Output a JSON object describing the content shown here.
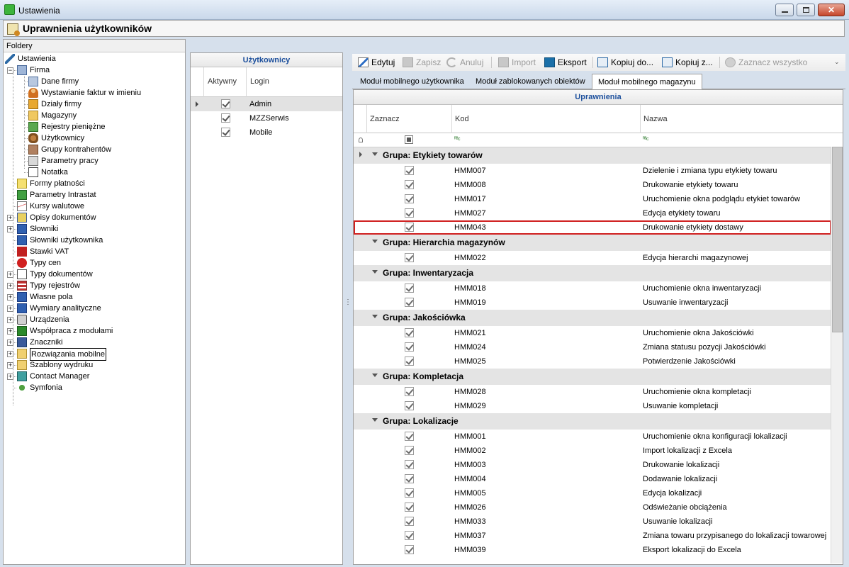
{
  "window": {
    "title": "Ustawienia",
    "close_glyph": "✕"
  },
  "header": {
    "title": "Uprawnienia użytkowników"
  },
  "folders": {
    "title": "Foldery",
    "items": [
      {
        "label": "Ustawienia",
        "icon": "tools-icon",
        "level": 0
      },
      {
        "label": "Firma",
        "icon": "company-icon",
        "level": 1,
        "expander": "−"
      },
      {
        "label": "Dane firmy",
        "icon": "company-data-icon",
        "level": 2
      },
      {
        "label": "Wystawianie faktur w imieniu",
        "icon": "person-icon",
        "level": 2
      },
      {
        "label": "Działy firmy",
        "icon": "departments-icon",
        "level": 2
      },
      {
        "label": "Magazyny",
        "icon": "warehouse-icon",
        "level": 2
      },
      {
        "label": "Rejestry pieniężne",
        "icon": "money-register-icon",
        "level": 2
      },
      {
        "label": "Użytkownicy",
        "icon": "users-icon",
        "level": 2
      },
      {
        "label": "Grupy kontrahentów",
        "icon": "contractor-groups-icon",
        "level": 2
      },
      {
        "label": "Parametry pracy",
        "icon": "parameters-icon",
        "level": 2
      },
      {
        "label": "Notatka",
        "icon": "note-icon",
        "level": 2
      },
      {
        "label": "Formy płatności",
        "icon": "payment-forms-icon",
        "level": 1
      },
      {
        "label": "Parametry Intrastat",
        "icon": "intrastat-icon",
        "level": 1
      },
      {
        "label": "Kursy walutowe",
        "icon": "currency-chart-icon",
        "level": 1
      },
      {
        "label": "Opisy dokumentów",
        "icon": "document-descriptions-icon",
        "level": 1,
        "expander": "+"
      },
      {
        "label": "Słowniki",
        "icon": "dictionary-icon",
        "level": 1,
        "expander": "+"
      },
      {
        "label": "Słowniki użytkownika",
        "icon": "user-dictionary-icon",
        "level": 1
      },
      {
        "label": "Stawki VAT",
        "icon": "vat-icon",
        "level": 1
      },
      {
        "label": "Typy cen",
        "icon": "price-types-icon",
        "level": 1
      },
      {
        "label": "Typy dokumentów",
        "icon": "document-types-icon",
        "level": 1,
        "expander": "+"
      },
      {
        "label": "Typy rejestrów",
        "icon": "register-types-icon",
        "level": 1,
        "expander": "+"
      },
      {
        "label": "Własne pola",
        "icon": "custom-fields-icon",
        "level": 1,
        "expander": "+"
      },
      {
        "label": "Wymiary analityczne",
        "icon": "analytical-dimensions-icon",
        "level": 1,
        "expander": "+"
      },
      {
        "label": "Urządzenia",
        "icon": "printer-icon",
        "level": 1,
        "expander": "+"
      },
      {
        "label": "Współpraca z modułami",
        "icon": "modules-icon",
        "level": 1,
        "expander": "+"
      },
      {
        "label": "Znaczniki",
        "icon": "tags-icon",
        "level": 1,
        "expander": "+"
      },
      {
        "label": "Rozwiązania mobilne",
        "icon": "folder-icon",
        "level": 1,
        "expander": "+",
        "selected": true
      },
      {
        "label": "Szablony wydruku",
        "icon": "folder-icon",
        "level": 1,
        "expander": "+"
      },
      {
        "label": "Contact Manager",
        "icon": "contact-manager-icon",
        "level": 1,
        "expander": "+"
      },
      {
        "label": "Symfonia",
        "icon": "symfonia-icon",
        "level": 1
      }
    ]
  },
  "users": {
    "title": "Użytkownicy",
    "columns": {
      "active": "Aktywny",
      "login": "Login"
    },
    "rows": [
      {
        "login": "Admin",
        "active": true,
        "current": true
      },
      {
        "login": "MZZSerwis",
        "active": true
      },
      {
        "login": "Mobile",
        "active": true
      }
    ]
  },
  "splitter": {
    "glyph": "⋮"
  },
  "toolbar": {
    "edit": "Edytuj",
    "save": "Zapisz",
    "cancel": "Anuluj",
    "import": "Import",
    "export": "Eksport",
    "copy_to": "Kopiuj do...",
    "copy_from": "Kopiuj z...",
    "select_all": "Zaznacz wszystko",
    "more_glyph": "⌄"
  },
  "tabs": [
    {
      "label": "Moduł mobilnego użytkownika",
      "active": false
    },
    {
      "label": "Moduł zablokowanych obiektów",
      "active": false
    },
    {
      "label": "Moduł mobilnego magazynu",
      "active": true
    }
  ],
  "permissions": {
    "title": "Uprawnienia",
    "columns": {
      "check": "Zaznacz",
      "code": "Kod",
      "name": "Nazwa"
    },
    "filter_abc": "ᴿᴮc",
    "groups": [
      {
        "label": "Grupa: Etykiety towarów",
        "items": [
          {
            "code": "HMM007",
            "name": "Dzielenie i zmiana typu etykiety towaru",
            "checked": true
          },
          {
            "code": "HMM008",
            "name": "Drukowanie etykiety towaru",
            "checked": true
          },
          {
            "code": "HMM017",
            "name": "Uruchomienie okna podglądu etykiet towarów",
            "checked": true
          },
          {
            "code": "HMM027",
            "name": "Edycja etykiety towaru",
            "checked": true
          },
          {
            "code": "HMM043",
            "name": "Drukowanie etykiety dostawy",
            "checked": true,
            "highlighted": true
          }
        ]
      },
      {
        "label": "Grupa: Hierarchia magazynów",
        "items": [
          {
            "code": "HMM022",
            "name": "Edycja hierarchi magazynowej",
            "checked": true
          }
        ]
      },
      {
        "label": "Grupa: Inwentaryzacja",
        "items": [
          {
            "code": "HMM018",
            "name": "Uruchomienie okna inwentaryzacji",
            "checked": true
          },
          {
            "code": "HMM019",
            "name": "Usuwanie inwentaryzacji",
            "checked": true
          }
        ]
      },
      {
        "label": "Grupa: Jakościówka",
        "items": [
          {
            "code": "HMM021",
            "name": "Uruchomienie okna Jakościówki",
            "checked": true
          },
          {
            "code": "HMM024",
            "name": "Zmiana statusu pozycji Jakościówki",
            "checked": true
          },
          {
            "code": "HMM025",
            "name": "Potwierdzenie Jakościówki",
            "checked": true
          }
        ]
      },
      {
        "label": "Grupa: Kompletacja",
        "items": [
          {
            "code": "HMM028",
            "name": "Uruchomienie okna kompletacji",
            "checked": true
          },
          {
            "code": "HMM029",
            "name": "Usuwanie kompletacji",
            "checked": true
          }
        ]
      },
      {
        "label": "Grupa: Lokalizacje",
        "items": [
          {
            "code": "HMM001",
            "name": "Uruchomienie okna konfiguracji lokalizacji",
            "checked": true
          },
          {
            "code": "HMM002",
            "name": "Import lokalizacji z Excela",
            "checked": true
          },
          {
            "code": "HMM003",
            "name": "Drukowanie lokalizacji",
            "checked": true
          },
          {
            "code": "HMM004",
            "name": "Dodawanie lokalizacji",
            "checked": true
          },
          {
            "code": "HMM005",
            "name": "Edycja lokalizacji",
            "checked": true
          },
          {
            "code": "HMM026",
            "name": "Odświeżanie obciążenia",
            "checked": true
          },
          {
            "code": "HMM033",
            "name": "Usuwanie lokalizacji",
            "checked": true
          },
          {
            "code": "HMM037",
            "name": "Zmiana towaru przypisanego do lokalizacji towarowej",
            "checked": true
          },
          {
            "code": "HMM039",
            "name": "Eksport lokalizacji do Excela",
            "checked": true
          }
        ]
      }
    ]
  },
  "colors": {
    "accent_title": "#1c4f9c",
    "highlight_border": "#d02020",
    "group_row_bg": "#e4e4e4"
  }
}
